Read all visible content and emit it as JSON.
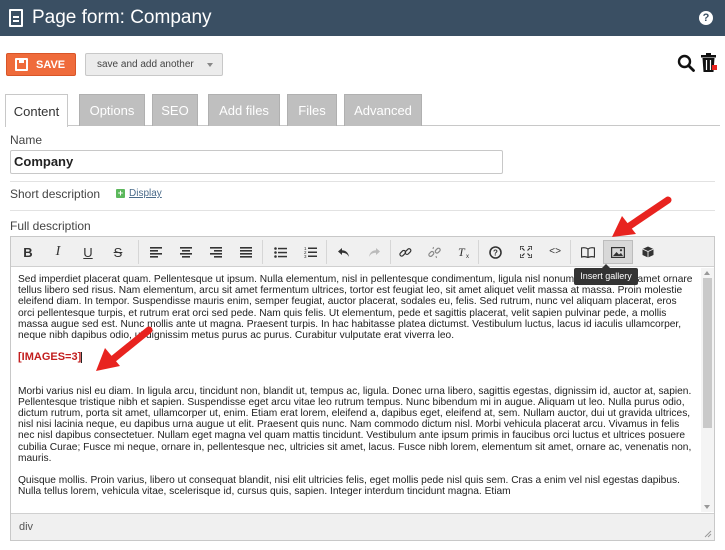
{
  "header": {
    "title": "Page form: Company",
    "help_label": "?"
  },
  "actions": {
    "save_label": "SAVE",
    "save_another_label": "save and add another"
  },
  "tabs": [
    {
      "label": "Content",
      "active": true
    },
    {
      "label": "Options",
      "active": false
    },
    {
      "label": "SEO",
      "active": false
    },
    {
      "label": "Add files",
      "active": false
    },
    {
      "label": "Files",
      "active": false
    },
    {
      "label": "Advanced",
      "active": false
    }
  ],
  "form": {
    "name_label": "Name",
    "name_value": "Company",
    "short_desc_label": "Short description",
    "display_link": "Display",
    "full_desc_label": "Full description"
  },
  "toolbar": {
    "bold": "B",
    "italic": "I",
    "underline": "U",
    "strike": "S",
    "tooltip": "Insert gallery"
  },
  "editor": {
    "paragraph1": "Sed imperdiet placerat quam. Pellentesque ut ipsum. Nulla elementum, nisl in pellentesque condimentum, ligula nisl nonummy augue, sit amet ornare tellus libero sed risus. Nam elementum, arcu sit amet fermentum ultrices, tortor est feugiat leo, sit amet aliquet velit massa at massa. Proin molestie eleifend diam. In tempor. Suspendisse mauris enim, semper feugiat, auctor placerat, sodales eu, felis. Sed rutrum, nunc vel aliquam placerat, eros orci pellentesque turpis, et rutrum erat orci sed pede. Nam quis felis. Ut elementum, pede et sagittis placerat, velit sapien pulvinar pede, a mollis massa augue sed est. Nunc mollis ante ut magna. Praesent turpis. In hac habitasse platea dictumst. Vestibulum luctus, lacus id iaculis ullamcorper, neque nibh dapibus odio, ut dignissim metus purus ac purus. Curabitur vulputate erat viverra leo.",
    "images_tag": "[IMAGES=3]",
    "paragraph2": "Morbi varius nisl eu diam. In ligula arcu, tincidunt non, blandit ut, tempus ac, ligula. Donec urna libero, sagittis egestas, dignissim id, auctor at, sapien. Pellentesque tristique nibh et sapien. Suspendisse eget arcu vitae leo rutrum tempus. Nunc bibendum mi in augue. Aliquam ut leo. Nulla purus odio, dictum rutrum, porta sit amet, ullamcorper ut, enim. Etiam erat lorem, eleifend a, dapibus eget, eleifend at, sem. Nullam auctor, dui ut gravida ultrices, nisl nisi lacinia neque, eu dapibus urna augue ut elit. Praesent quis nunc. Nam commodo dictum nisl. Morbi vehicula placerat arcu. Vivamus in felis nec nisl dapibus consectetuer. Nullam eget magna vel quam mattis tincidunt. Vestibulum ante ipsum primis in faucibus orci luctus et ultrices posuere cubilia Curae; Fusce mi neque, ornare in, pellentesque nec, ultricies sit amet, lacus. Fusce nibh lorem, elementum sit amet, ornare ac, venenatis non, mauris.",
    "paragraph3": "Quisque mollis. Proin varius, libero ut consequat blandit, nisi elit ultricies felis, eget mollis pede nisl quis sem. Cras a enim vel nisl egestas dapibus. Nulla tellus lorem, vehicula vitae, scelerisque id, cursus quis, sapien. Integer interdum tincidunt magna. Etiam",
    "status_path": "div"
  },
  "colors": {
    "header_bg": "#3a4f63",
    "save_bg": "#ef6b3b",
    "arrow": "#e8231f",
    "images_tag": "#c21e1e"
  }
}
